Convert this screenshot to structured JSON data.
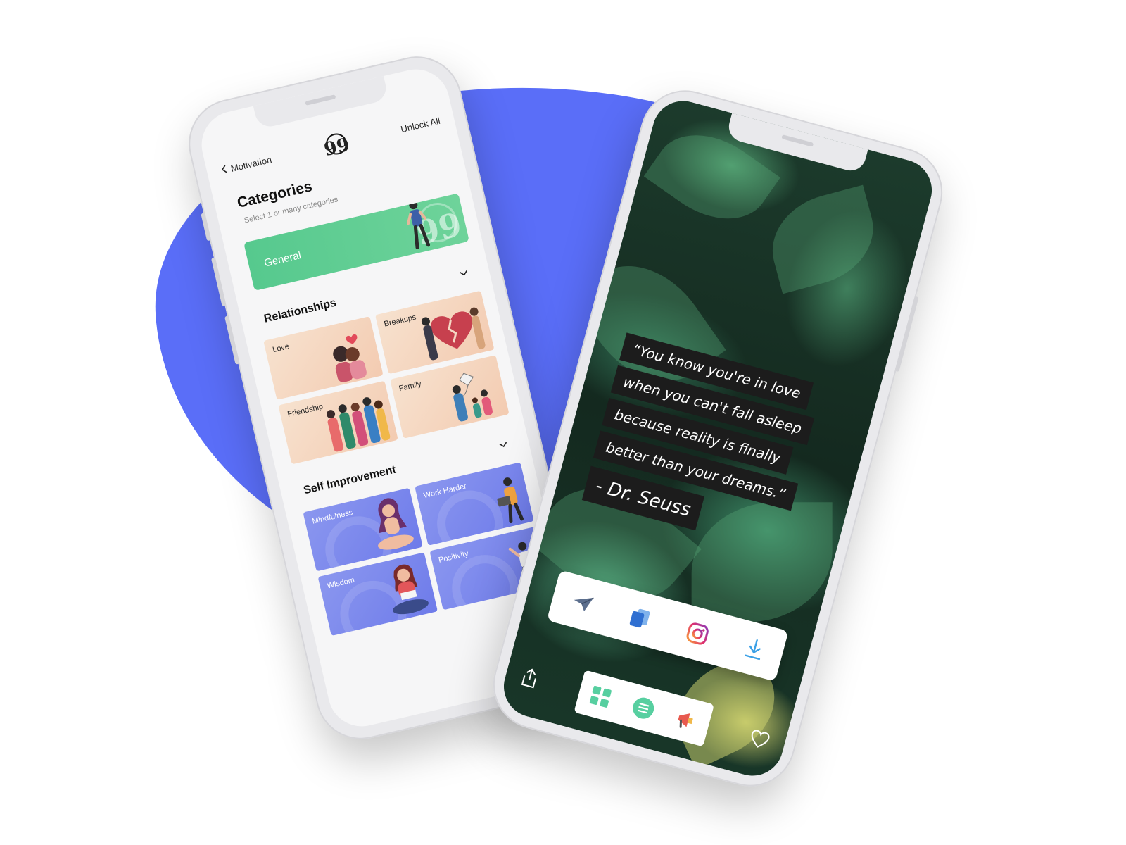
{
  "left_phone": {
    "topbar": {
      "back_label": "Motivation",
      "logo_glyph": "99",
      "unlock_label": "Unlock All"
    },
    "categories": {
      "title": "Categories",
      "subtitle": "Select 1 or many categories",
      "featured": "General"
    },
    "sections": [
      {
        "title": "Relationships",
        "items": [
          "Love",
          "Breakups",
          "Friendship",
          "Family"
        ]
      },
      {
        "title": "Self Improvement",
        "items": [
          "Mindfulness",
          "Work Harder",
          "Wisdom",
          "Positivity"
        ]
      }
    ]
  },
  "right_phone": {
    "quote_lines": [
      "“You know you're in love",
      "when you can't fall asleep",
      "because reality is finally",
      "better than your dreams.”"
    ],
    "author": "- Dr. Seuss",
    "share_icons": [
      "send-icon",
      "copy-icon",
      "instagram-icon",
      "download-icon"
    ],
    "tab_icons": [
      "share-icon",
      "grid-icon",
      "list-icon",
      "megaphone-icon",
      "heart-icon"
    ]
  },
  "colors": {
    "blob": "#5a6ef8",
    "green": "#5ccb8f",
    "accent_blue": "#3b8be0",
    "tab_green": "#57cfa0"
  }
}
